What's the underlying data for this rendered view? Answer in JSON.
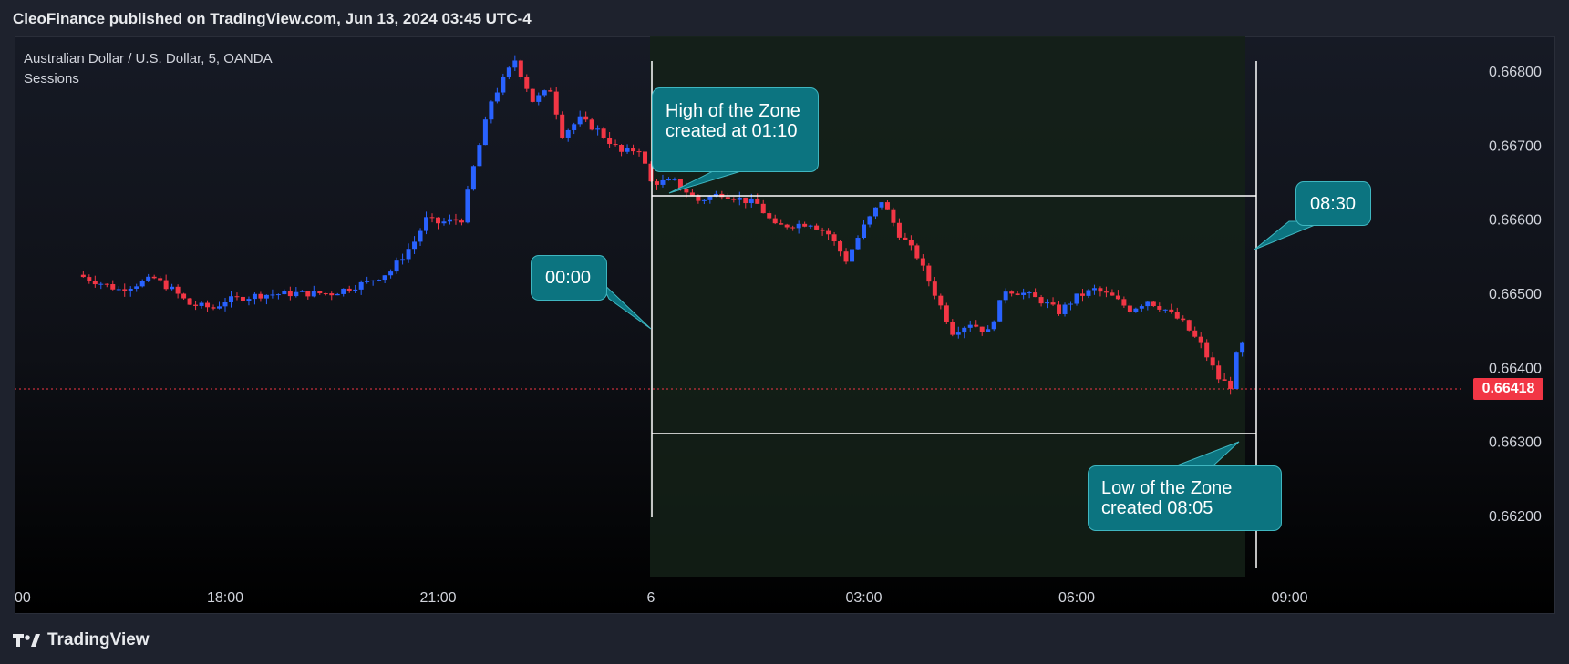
{
  "header": {
    "text": "CleoFinance published on TradingView.com, Jun 13, 2024 03:45 UTC-4"
  },
  "legend": {
    "symbol": "Australian Dollar / U.S. Dollar, 5, OANDA",
    "indicator": "Sessions"
  },
  "footer": {
    "brand": "TradingView",
    "logo_icon": "tradingview-logo-icon"
  },
  "callouts": {
    "high": "High of the Zone created at 01:10",
    "low": "Low of the Zone created 08:05",
    "start": "00:00",
    "end": "08:30"
  },
  "price_tag": "0.66418",
  "colors": {
    "up": "#2962ff",
    "down": "#f23645",
    "callout": "#0c7480",
    "session": "#17261b"
  },
  "chart_data": {
    "type": "candlestick",
    "title": "Australian Dollar / U.S. Dollar, 5, OANDA",
    "x_ticks": [
      "00",
      "18:00",
      "21:00",
      "6",
      "03:00",
      "06:00",
      "09:00"
    ],
    "y_ticks": [
      "0.66800",
      "0.66700",
      "0.66600",
      "0.66500",
      "0.66400",
      "0.66300",
      "0.66200"
    ],
    "ylim": [
      0.6618,
      0.6684
    ],
    "current_price": 0.66418,
    "zone": {
      "high": 0.66657,
      "low": 0.66365,
      "start": "00:00",
      "end": "08:30"
    },
    "close_path": [
      [
        "15:55",
        0.66525
      ],
      [
        "16:30",
        0.66505
      ],
      [
        "17:00",
        0.6652
      ],
      [
        "17:15",
        0.66505
      ],
      [
        "17:30",
        0.66485
      ],
      [
        "17:50",
        0.6648
      ],
      [
        "18:00",
        0.6649
      ],
      [
        "18:30",
        0.66498
      ],
      [
        "19:00",
        0.665
      ],
      [
        "19:30",
        0.665
      ],
      [
        "20:00",
        0.66515
      ],
      [
        "20:20",
        0.6653
      ],
      [
        "20:40",
        0.6657
      ],
      [
        "20:50",
        0.666
      ],
      [
        "21:00",
        0.66595
      ],
      [
        "21:20",
        0.666
      ],
      [
        "21:30",
        0.6667
      ],
      [
        "21:45",
        0.6676
      ],
      [
        "22:05",
        0.66815
      ],
      [
        "22:20",
        0.6676
      ],
      [
        "22:35",
        0.66775
      ],
      [
        "22:45",
        0.66715
      ],
      [
        "23:00",
        0.66735
      ],
      [
        "23:15",
        0.6672
      ],
      [
        "23:35",
        0.6669
      ],
      [
        "23:50",
        0.66695
      ],
      [
        "00:00",
        0.6665
      ],
      [
        "00:20",
        0.6665
      ],
      [
        "00:40",
        0.66625
      ],
      [
        "01:00",
        0.66635
      ],
      [
        "01:30",
        0.6662
      ],
      [
        "01:45",
        0.6659
      ],
      [
        "02:15",
        0.66595
      ],
      [
        "02:30",
        0.6658
      ],
      [
        "02:45",
        0.66545
      ],
      [
        "03:00",
        0.6659
      ],
      [
        "03:15",
        0.66625
      ],
      [
        "03:30",
        0.6658
      ],
      [
        "03:45",
        0.6655
      ],
      [
        "04:00",
        0.665
      ],
      [
        "04:15",
        0.66448
      ],
      [
        "04:30",
        0.6646
      ],
      [
        "04:45",
        0.66448
      ],
      [
        "05:00",
        0.66505
      ],
      [
        "05:15",
        0.665
      ],
      [
        "05:30",
        0.6649
      ],
      [
        "05:45",
        0.66475
      ],
      [
        "06:00",
        0.66495
      ],
      [
        "06:15",
        0.66505
      ],
      [
        "06:30",
        0.66495
      ],
      [
        "06:45",
        0.66478
      ],
      [
        "07:00",
        0.6649
      ],
      [
        "07:15",
        0.66478
      ],
      [
        "07:30",
        0.6646
      ],
      [
        "07:45",
        0.6643
      ],
      [
        "08:00",
        0.66385
      ],
      [
        "08:10",
        0.66375
      ],
      [
        "08:15",
        0.66415
      ],
      [
        "08:20",
        0.6643
      ]
    ]
  }
}
